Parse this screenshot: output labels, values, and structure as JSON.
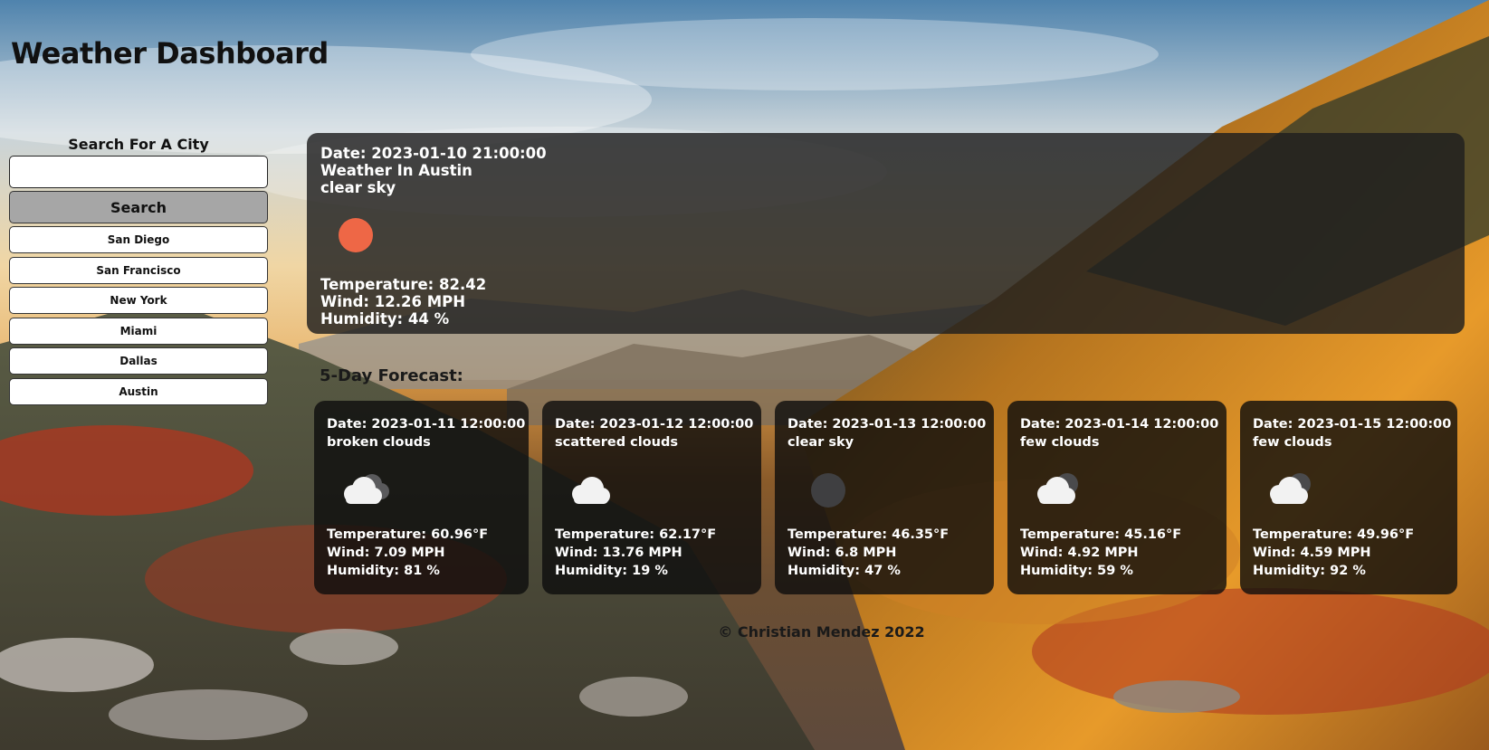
{
  "app": {
    "title": "Weather Dashboard"
  },
  "sidebar": {
    "search_label": "Search For A City",
    "search_placeholder": "",
    "search_value": "",
    "search_button": "Search",
    "cities": [
      "San Diego",
      "San Francisco",
      "New York",
      "Miami",
      "Dallas",
      "Austin"
    ]
  },
  "current": {
    "date": "Date: 2023-01-10 21:00:00",
    "location": "Weather In Austin",
    "description": "clear sky",
    "icon": "clear-sky-icon",
    "temperature": "Temperature: 82.42",
    "wind": "Wind: 12.26 MPH",
    "humidity": "Humidity: 44 %"
  },
  "forecast": {
    "heading": "5-Day Forecast:",
    "days": [
      {
        "date": "Date: 2023-01-11 12:00:00",
        "description": "broken clouds",
        "icon": "broken-clouds-icon",
        "temperature": "Temperature: 60.96°F",
        "wind": "Wind: 7.09 MPH",
        "humidity": "Humidity: 81 %"
      },
      {
        "date": "Date: 2023-01-12 12:00:00",
        "description": "scattered clouds",
        "icon": "scattered-clouds-icon",
        "temperature": "Temperature: 62.17°F",
        "wind": "Wind: 13.76 MPH",
        "humidity": "Humidity: 19 %"
      },
      {
        "date": "Date: 2023-01-13 12:00:00",
        "description": "clear sky",
        "icon": "clear-sky-night-icon",
        "temperature": "Temperature: 46.35°F",
        "wind": "Wind: 6.8 MPH",
        "humidity": "Humidity: 47 %"
      },
      {
        "date": "Date: 2023-01-14 12:00:00",
        "description": "few clouds",
        "icon": "few-clouds-icon",
        "temperature": "Temperature: 45.16°F",
        "wind": "Wind: 4.92 MPH",
        "humidity": "Humidity: 59 %"
      },
      {
        "date": "Date: 2023-01-15 12:00:00",
        "description": "few clouds",
        "icon": "few-clouds-icon",
        "temperature": "Temperature: 49.96°F",
        "wind": "Wind: 4.59 MPH",
        "humidity": "Humidity: 92 %"
      }
    ]
  },
  "footer": {
    "text": "© Christian Mendez 2022"
  },
  "colors": {
    "sun": "#ee6746",
    "card_bg": "#1e1e1e",
    "search_button_bg": "#a6a6a6"
  }
}
